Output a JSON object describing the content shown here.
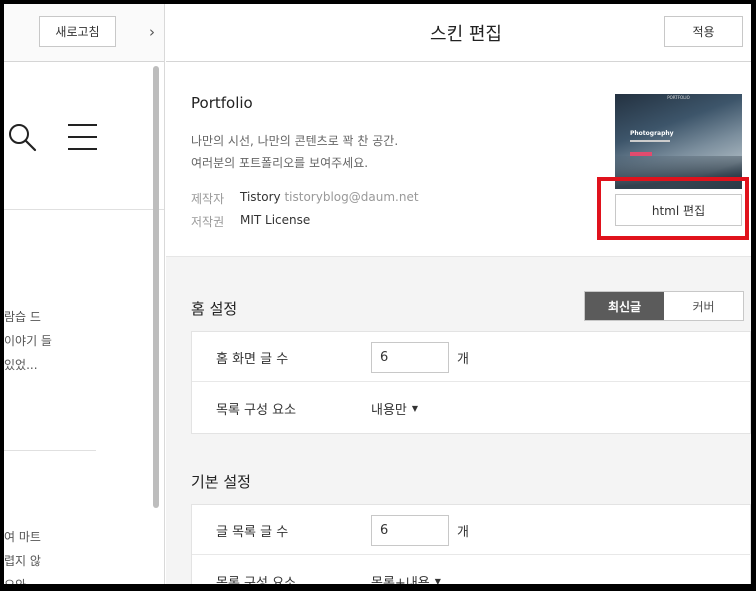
{
  "left_panel": {
    "refresh_label": "새로고침",
    "collapse_arrow": "›",
    "snippets_a": [
      "람습 드",
      "이야기 들",
      "있었..."
    ],
    "snippets_b": [
      "여 마트",
      "렵지 않",
      "으와..."
    ]
  },
  "header": {
    "title": "스킨 편집",
    "apply_label": "적용"
  },
  "skin": {
    "name": "Portfolio",
    "desc_line1": "나만의 시선, 나만의 콘텐츠로 꽉 찬 공간.",
    "desc_line2": "여러분의 포트폴리오를 보여주세요.",
    "author_label": "제작자",
    "author_name": "Tistory",
    "author_email": "tistoryblog@daum.net",
    "license_label": "저작권",
    "license_value": "MIT License",
    "thumb_brand": "PORTFOLIO",
    "thumb_title": "Photography",
    "html_edit_label": "html 편집"
  },
  "home_settings": {
    "title": "홈 설정",
    "tab_latest": "최신글",
    "tab_cover": "커버",
    "posts_label": "홈 화면 글 수",
    "posts_value": "6",
    "posts_unit": "개",
    "list_label": "목록 구성 요소",
    "list_value": "내용만"
  },
  "basic_settings": {
    "title": "기본 설정",
    "posts_label": "글 목록 글 수",
    "posts_value": "6",
    "posts_unit": "개",
    "list_label": "목록 구성 요소",
    "list_value": "목록+내용"
  },
  "colors": {
    "highlight": "#e0121c",
    "tab_active": "#5b5b5b"
  }
}
